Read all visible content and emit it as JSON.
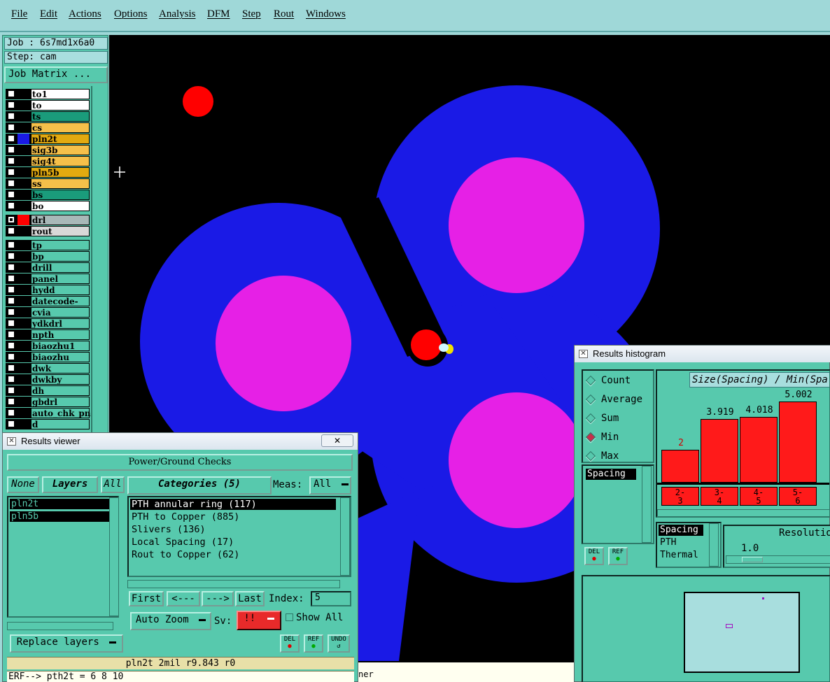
{
  "menu": [
    "File",
    "Edit",
    "Actions",
    "Options",
    "Analysis",
    "DFM",
    "Step",
    "Rout",
    "Windows"
  ],
  "job_line": "Job : 6s7md1x6a0",
  "step_line": "Step: cam",
  "job_matrix_label": "Job Matrix ...",
  "layers_board": [
    {
      "name": "to1",
      "color": "#ffffff"
    },
    {
      "name": "to",
      "color": "#ffffff"
    },
    {
      "name": "ts",
      "color": "#1a9c7b"
    },
    {
      "name": "cs",
      "color": "#f5c04a"
    },
    {
      "name": "pln2t",
      "color": "#e2aa10"
    },
    {
      "name": "sig3b",
      "color": "#f5c04a"
    },
    {
      "name": "sig4t",
      "color": "#f5c04a"
    },
    {
      "name": "pln5b",
      "color": "#e2aa10"
    },
    {
      "name": "ss",
      "color": "#f5c04a"
    },
    {
      "name": "bs",
      "color": "#1a9c7b"
    },
    {
      "name": "bo",
      "color": "#ffffff"
    }
  ],
  "layers_drill": [
    {
      "name": "drl",
      "color": "#a8b8b8"
    },
    {
      "name": "rout",
      "color": "#d8d8d8"
    }
  ],
  "layers_misc": [
    "tp",
    "bp",
    "drill",
    "panel",
    "hydd",
    "datecode-bo",
    "cvia",
    "ydkdrl",
    "npth",
    "biaozhu1",
    "biaozhu",
    "dwk",
    "dwkby",
    "dh",
    "gbdrl",
    "auto_chk_pn",
    "d"
  ],
  "colors": {
    "copper_blue": "#1a1ae6",
    "pad_magenta": "#e620e6",
    "drill_red": "#ff0000",
    "panel_teal": "#57c9ad",
    "bar_red": "#ff1a1a"
  },
  "results_viewer": {
    "title": "Results viewer",
    "header": "Power/Ground Checks",
    "btn_none": "None",
    "layers_label": "Layers",
    "btn_all": "All",
    "layers": [
      "pln2t",
      "pln5b"
    ],
    "categories_label": "Categories (5)",
    "meas_label": "Meas:",
    "meas_value": "All",
    "categories": [
      "PTH annular ring (117)",
      "PTH to Copper (885)",
      "Slivers (136)",
      "Local Spacing (17)",
      "Rout to Copper (62)"
    ],
    "nav": {
      "first": "First",
      "prev": "<---",
      "next": "--->",
      "last": "Last",
      "index_label": "Index:",
      "index_value": "5"
    },
    "auto_zoom": "Auto Zoom",
    "sv_label": "Sv:",
    "sv_value": "!!",
    "show_all": "Show All",
    "replace_layers": "Replace layers",
    "del_label": "DEL",
    "ref_label": "REF",
    "undo_label": "UNDO",
    "status_line": "pln2t 2mil   r9.843   r0",
    "erf_line": "ERF--> pth2t = 6 8 10",
    "bottom_tail": "ner"
  },
  "histogram": {
    "title": "Results histogram",
    "modes": [
      "Count",
      "Average",
      "Sum",
      "Min",
      "Max"
    ],
    "selected_mode": "Min",
    "chart_title": "Size(Spacing) / Min(Spa",
    "spacing_label": "Spacing",
    "del_label": "DEL",
    "ref_label": "REF",
    "types": [
      "Spacing",
      "PTH",
      "Thermal"
    ],
    "resolution_label": "Resolutio",
    "resolution_value": "1.0"
  },
  "chart_data": {
    "type": "bar",
    "title": "Size(Spacing) / Min(Spa",
    "categories": [
      "2-3",
      "3-4",
      "4-5",
      "5-6"
    ],
    "values": [
      2,
      3.919,
      4.018,
      5.002
    ],
    "value_labels": [
      "2",
      "3.919",
      "4.018",
      "5.002"
    ],
    "ylim": [
      0,
      5.5
    ],
    "grid": false,
    "legend": "none"
  }
}
